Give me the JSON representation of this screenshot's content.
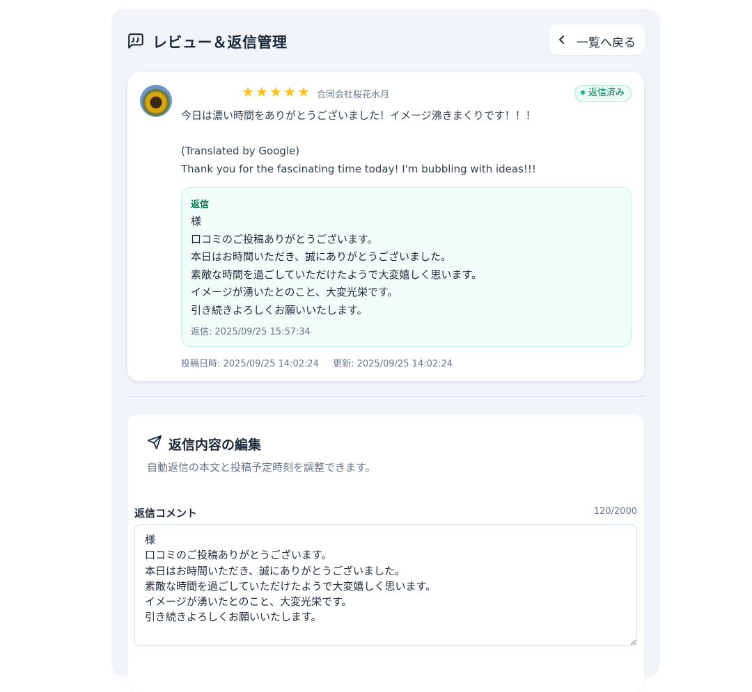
{
  "header": {
    "title": "レビュー＆返信管理",
    "back_label": "一覧へ戻る"
  },
  "review": {
    "reviewer_name": "",
    "rating": 5,
    "max_rating": 5,
    "business_name": "合同会社桜花水月",
    "status": "返信済み",
    "text": "今日は濃い時間をありがとうございました！イメージ沸きまくりです！！！\n\n(Translated by Google)\nThank you for the fascinating time today! I'm bubbling with ideas!!!",
    "reply": {
      "label": "返信",
      "text": "様\n口コミのご投稿ありがとうございます。\n本日はお時間いただき、誠にありがとうございました。\n素敵な時間を過ごしていただけたようで大変嬉しく思います。\nイメージが湧いたとのこと、大変光栄です。\n引き続きよろしくお願いいたします。",
      "date": "返信: 2025/09/25 15:57:34"
    },
    "posted": "投稿日時: 2025/09/25 14:02:24",
    "updated": "更新: 2025/09/25 14:02:24"
  },
  "edit": {
    "title": "返信内容の編集",
    "description": "自動返信の本文と投稿予定時刻を調整できます。",
    "field_label": "返信コメント",
    "char_count": "120/2000",
    "comment": "様\n口コミのご投稿ありがとうございます。\n本日はお時間いただき、誠にありがとうございました。\n素敵な時間を過ごしていただけたようで大変嬉しく思います。\nイメージが湧いたとのこと、大変光栄です。\n引き続きよろしくお願いいたします。"
  },
  "colors": {
    "panel_bg": "#f1f5f9",
    "accent_green": "#047857",
    "star": "#fbbf24"
  }
}
